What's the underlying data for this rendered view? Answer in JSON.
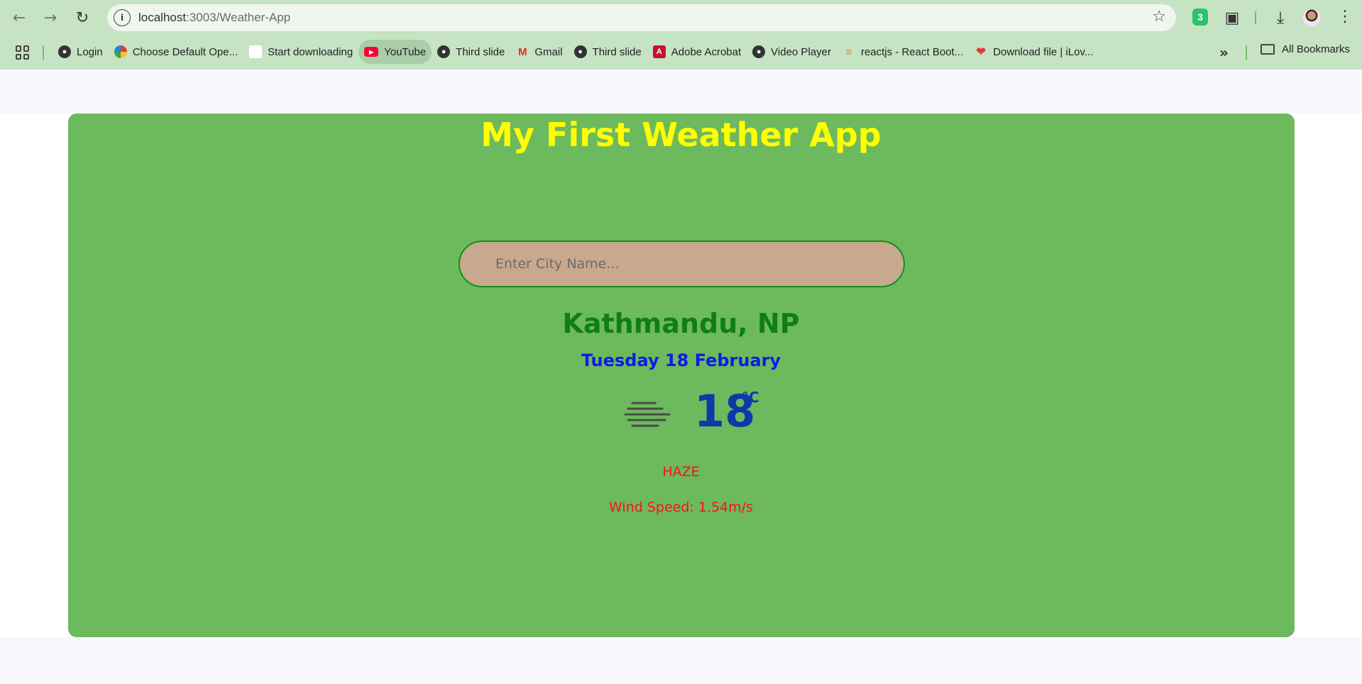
{
  "browser": {
    "url_host": "localhost",
    "url_path": ":3003/Weather-App",
    "extension_badge": "3"
  },
  "bookmarks": {
    "items": [
      {
        "label": "Login",
        "icon": "globe-icon"
      },
      {
        "label": "Choose Default Ope...",
        "icon": "color-wheel-icon"
      },
      {
        "label": "Start downloading",
        "icon": "blank-page-icon"
      },
      {
        "label": "YouTube",
        "icon": "youtube-icon"
      },
      {
        "label": "Third slide",
        "icon": "globe-icon"
      },
      {
        "label": "Gmail",
        "icon": "gmail-icon"
      },
      {
        "label": "Third slide",
        "icon": "globe-icon"
      },
      {
        "label": "Adobe Acrobat",
        "icon": "pdf-icon"
      },
      {
        "label": "Video Player",
        "icon": "globe-icon"
      },
      {
        "label": "reactjs - React Boot...",
        "icon": "stackoverflow-icon"
      },
      {
        "label": "Download file | iLov...",
        "icon": "heart-icon"
      }
    ],
    "all_bookmarks_label": "All Bookmarks"
  },
  "app": {
    "title": "My First Weather App",
    "search_placeholder": "Enter City Name...",
    "city": "Kathmandu, NP",
    "date": "Tuesday 18 February",
    "weather_icon": "haze-icon",
    "temperature": "18",
    "unit": "°C",
    "condition": "HAZE",
    "wind_label": "Wind Speed: 1.54m/s"
  },
  "colors": {
    "card_bg": "#6db95d",
    "title": "#ffff00",
    "city": "#0f7f10",
    "date": "#0f1ae8",
    "temperature": "#0e3aa8",
    "condition": "#ff1010",
    "chrome_bg": "#c6e3c4"
  }
}
